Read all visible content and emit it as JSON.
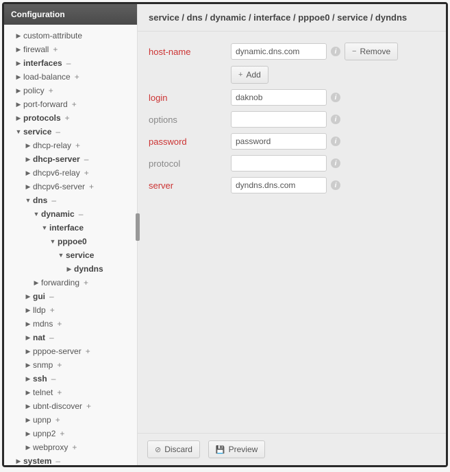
{
  "sidebar": {
    "title": "Configuration",
    "tree": [
      {
        "label": "custom-attribute",
        "arrow": "right",
        "indent": 1,
        "bold": false,
        "suffix": ""
      },
      {
        "label": "firewall",
        "arrow": "right",
        "indent": 1,
        "bold": false,
        "suffix": "+"
      },
      {
        "label": "interfaces",
        "arrow": "right",
        "indent": 1,
        "bold": true,
        "suffix": "–"
      },
      {
        "label": "load-balance",
        "arrow": "right",
        "indent": 1,
        "bold": false,
        "suffix": "+"
      },
      {
        "label": "policy",
        "arrow": "right",
        "indent": 1,
        "bold": false,
        "suffix": "+"
      },
      {
        "label": "port-forward",
        "arrow": "right",
        "indent": 1,
        "bold": false,
        "suffix": "+"
      },
      {
        "label": "protocols",
        "arrow": "right",
        "indent": 1,
        "bold": true,
        "suffix": "+"
      },
      {
        "label": "service",
        "arrow": "down",
        "indent": 1,
        "bold": true,
        "suffix": "–"
      },
      {
        "label": "dhcp-relay",
        "arrow": "right",
        "indent": 2,
        "bold": false,
        "suffix": "+"
      },
      {
        "label": "dhcp-server",
        "arrow": "right",
        "indent": 2,
        "bold": true,
        "suffix": "–"
      },
      {
        "label": "dhcpv6-relay",
        "arrow": "right",
        "indent": 2,
        "bold": false,
        "suffix": "+"
      },
      {
        "label": "dhcpv6-server",
        "arrow": "right",
        "indent": 2,
        "bold": false,
        "suffix": "+"
      },
      {
        "label": "dns",
        "arrow": "down",
        "indent": 2,
        "bold": true,
        "suffix": "–"
      },
      {
        "label": "dynamic",
        "arrow": "down",
        "indent": 3,
        "bold": true,
        "suffix": "–"
      },
      {
        "label": "interface",
        "arrow": "down",
        "indent": 4,
        "bold": true,
        "suffix": ""
      },
      {
        "label": "pppoe0",
        "arrow": "down",
        "indent": 5,
        "bold": true,
        "suffix": ""
      },
      {
        "label": "service",
        "arrow": "down",
        "indent": 6,
        "bold": true,
        "suffix": ""
      },
      {
        "label": "dyndns",
        "arrow": "right",
        "indent": 7,
        "bold": true,
        "suffix": ""
      },
      {
        "label": "forwarding",
        "arrow": "right",
        "indent": 3,
        "bold": false,
        "suffix": "+"
      },
      {
        "label": "gui",
        "arrow": "right",
        "indent": 2,
        "bold": true,
        "suffix": "–"
      },
      {
        "label": "lldp",
        "arrow": "right",
        "indent": 2,
        "bold": false,
        "suffix": "+"
      },
      {
        "label": "mdns",
        "arrow": "right",
        "indent": 2,
        "bold": false,
        "suffix": "+"
      },
      {
        "label": "nat",
        "arrow": "right",
        "indent": 2,
        "bold": true,
        "suffix": "–"
      },
      {
        "label": "pppoe-server",
        "arrow": "right",
        "indent": 2,
        "bold": false,
        "suffix": "+"
      },
      {
        "label": "snmp",
        "arrow": "right",
        "indent": 2,
        "bold": false,
        "suffix": "+"
      },
      {
        "label": "ssh",
        "arrow": "right",
        "indent": 2,
        "bold": true,
        "suffix": "–"
      },
      {
        "label": "telnet",
        "arrow": "right",
        "indent": 2,
        "bold": false,
        "suffix": "+"
      },
      {
        "label": "ubnt-discover",
        "arrow": "right",
        "indent": 2,
        "bold": false,
        "suffix": "+"
      },
      {
        "label": "upnp",
        "arrow": "right",
        "indent": 2,
        "bold": false,
        "suffix": "+"
      },
      {
        "label": "upnp2",
        "arrow": "right",
        "indent": 2,
        "bold": false,
        "suffix": "+"
      },
      {
        "label": "webproxy",
        "arrow": "right",
        "indent": 2,
        "bold": false,
        "suffix": "+"
      },
      {
        "label": "system",
        "arrow": "right",
        "indent": 1,
        "bold": true,
        "suffix": "–"
      }
    ]
  },
  "breadcrumb": "service / dns / dynamic / interface / pppoe0 / service / dyndns",
  "form": {
    "hostname": {
      "label": "host-name",
      "value": "dynamic.dns.com",
      "required": true
    },
    "add": "Add",
    "remove": "Remove",
    "login": {
      "label": "login",
      "value": "daknob",
      "required": true
    },
    "options": {
      "label": "options",
      "value": "",
      "required": false
    },
    "password": {
      "label": "password",
      "value": "password",
      "required": true
    },
    "protocol": {
      "label": "protocol",
      "value": "",
      "required": false
    },
    "server": {
      "label": "server",
      "value": "dyndns.dns.com",
      "required": true
    }
  },
  "footer": {
    "discard": "Discard",
    "preview": "Preview"
  }
}
